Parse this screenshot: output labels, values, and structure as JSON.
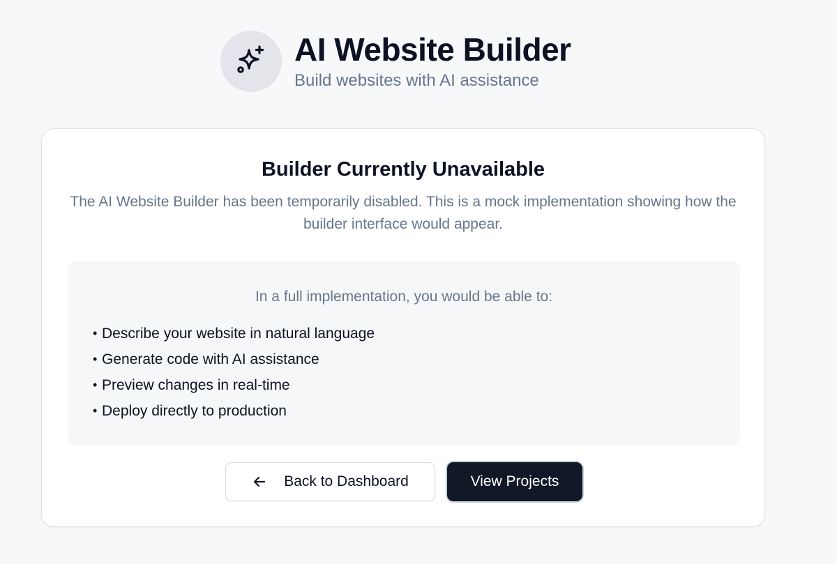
{
  "header": {
    "icon": "sparkles-icon",
    "title": "AI Website Builder",
    "subtitle": "Build websites with AI assistance"
  },
  "card": {
    "title": "Builder Currently Unavailable",
    "description": "The AI Website Builder has been temporarily disabled. This is a mock implementation showing how the builder interface would appear."
  },
  "features": {
    "intro": "In a full implementation, you would be able to:",
    "bullet": "•",
    "items": [
      "Describe your website in natural language",
      "Generate code with AI assistance",
      "Preview changes in real-time",
      "Deploy directly to production"
    ]
  },
  "actions": {
    "back_label": "Back to Dashboard",
    "back_icon": "arrow-left-icon",
    "projects_label": "View Projects"
  },
  "colors": {
    "background": "#f7f8fa",
    "primary": "#111827",
    "muted_text": "#66768b",
    "heading_text": "#0c1222"
  }
}
